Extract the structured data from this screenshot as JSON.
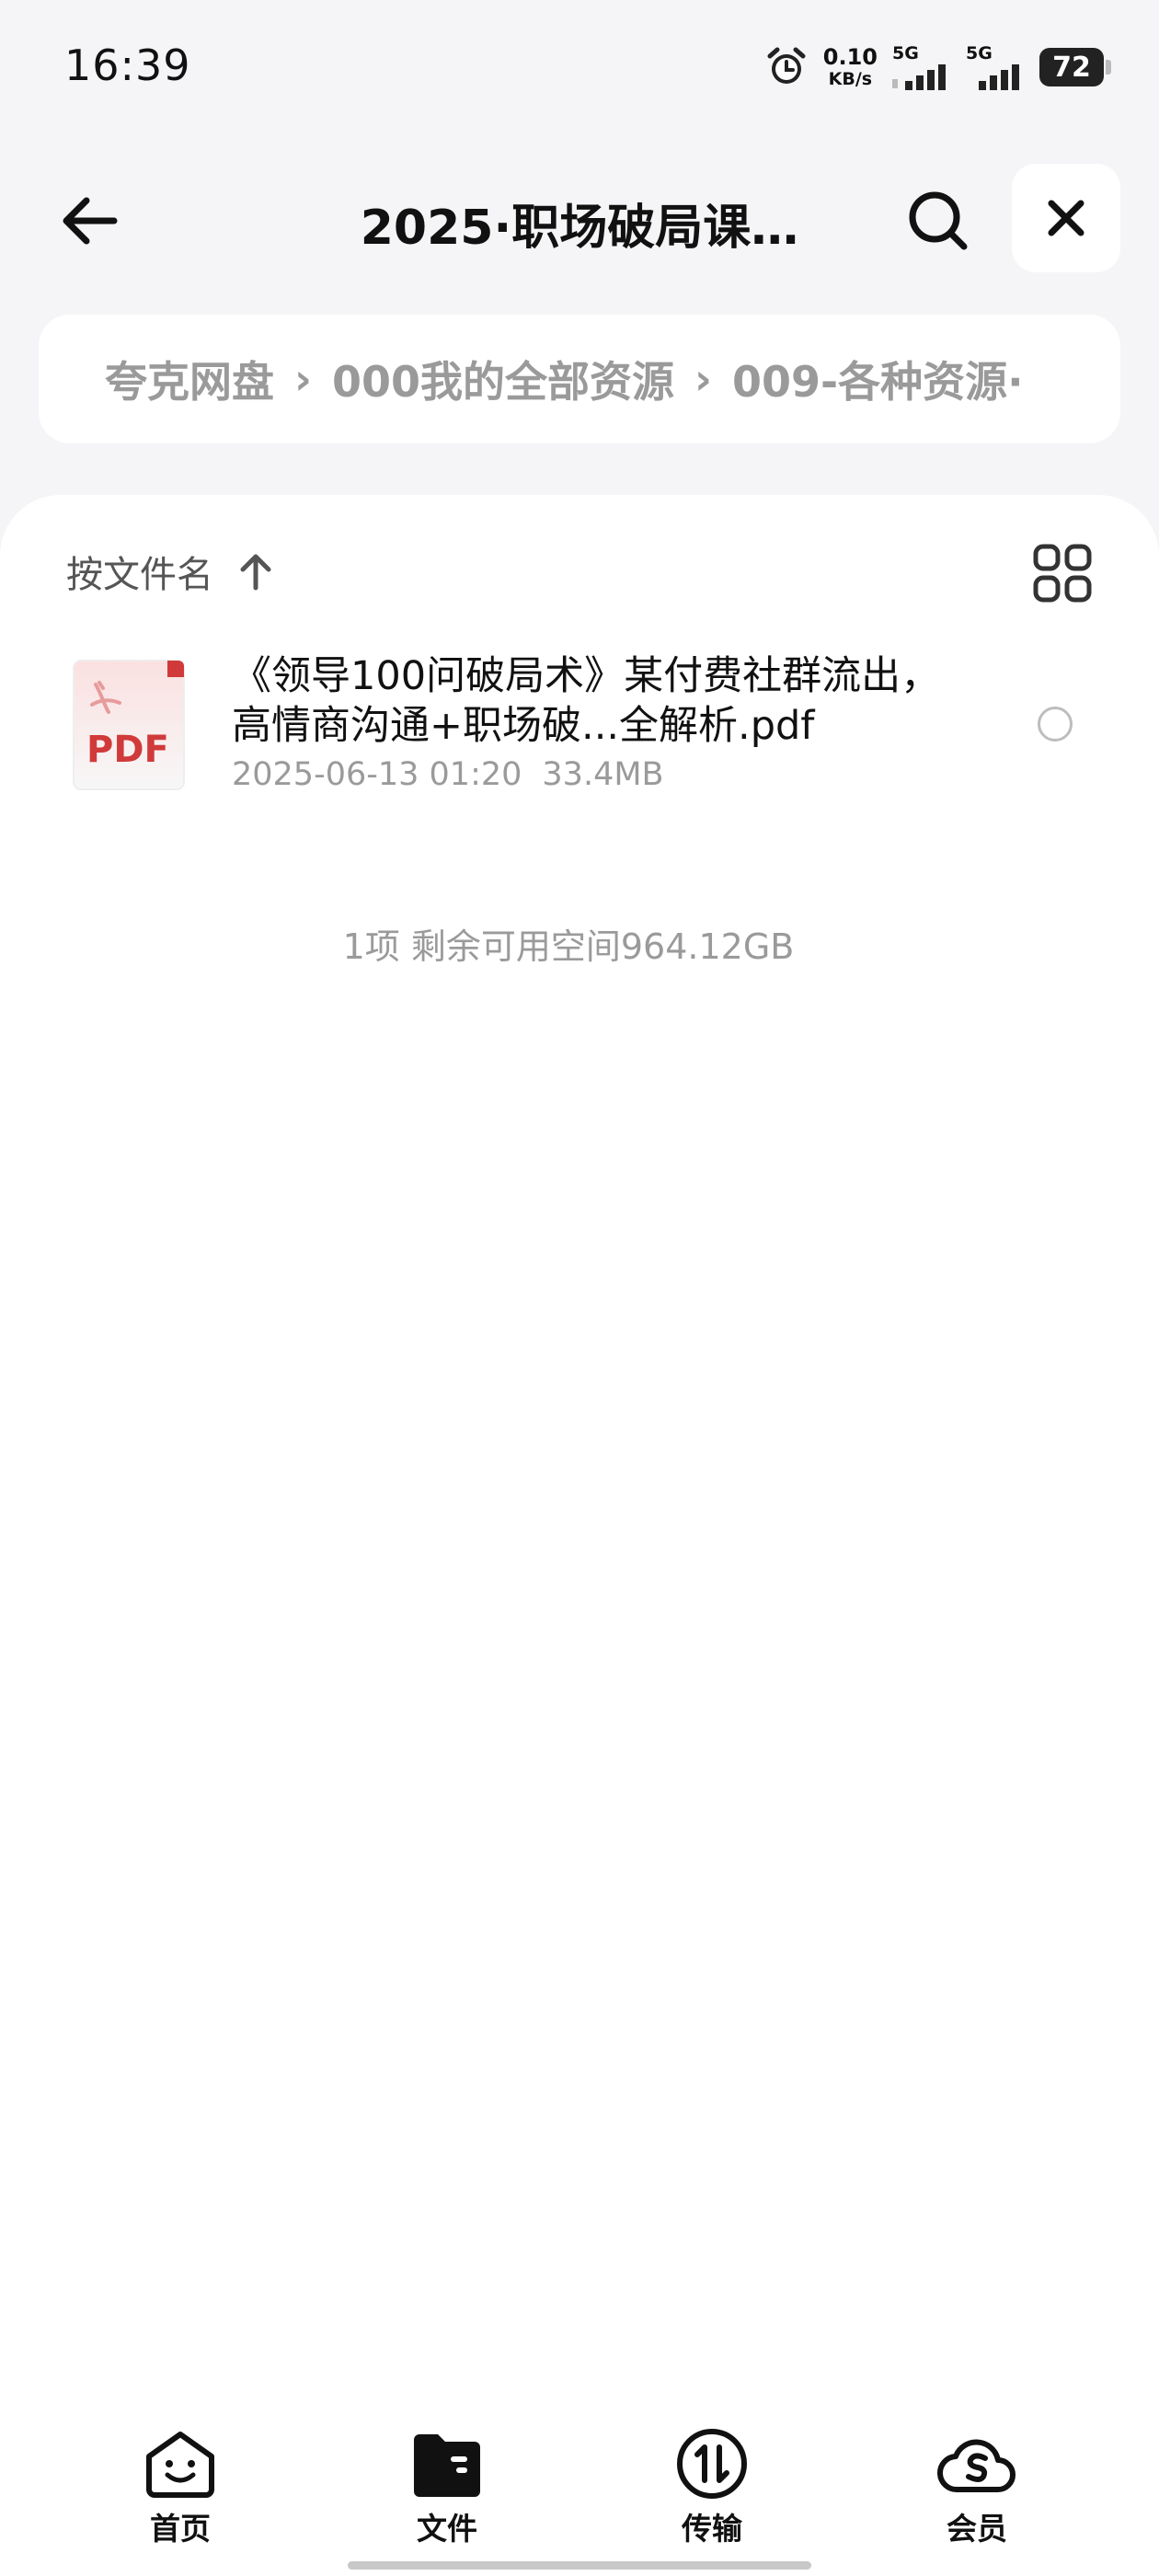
{
  "status": {
    "time": "16:39",
    "net_speed_value": "0.10",
    "net_speed_unit": "KB/s",
    "sim1": "5G",
    "sim2": "5G",
    "battery": "72"
  },
  "header": {
    "title": "2025·职场破局课…"
  },
  "breadcrumb": [
    "夸克网盘",
    "000我的全部资源",
    "009-各种资源·"
  ],
  "sort": {
    "label": "按文件名"
  },
  "files": [
    {
      "name": "《领导100问破局术》某付费社群流出，高情商沟通+职场破...全解析.pdf",
      "date": "2025-06-13 01:20",
      "size": "33.4MB",
      "icon_text": "PDF",
      "icon": "pdf-file-icon"
    }
  ],
  "summary": "1项 剩余可用空间964.12GB",
  "nav": [
    {
      "label": "首页",
      "icon": "home-smile-icon"
    },
    {
      "label": "文件",
      "icon": "folder-icon"
    },
    {
      "label": "传输",
      "icon": "transfer-icon"
    },
    {
      "label": "会员",
      "icon": "cloud-vip-icon"
    }
  ],
  "colors": {
    "pdf_red": "#d13a3a",
    "muted": "#9a9a9a"
  }
}
